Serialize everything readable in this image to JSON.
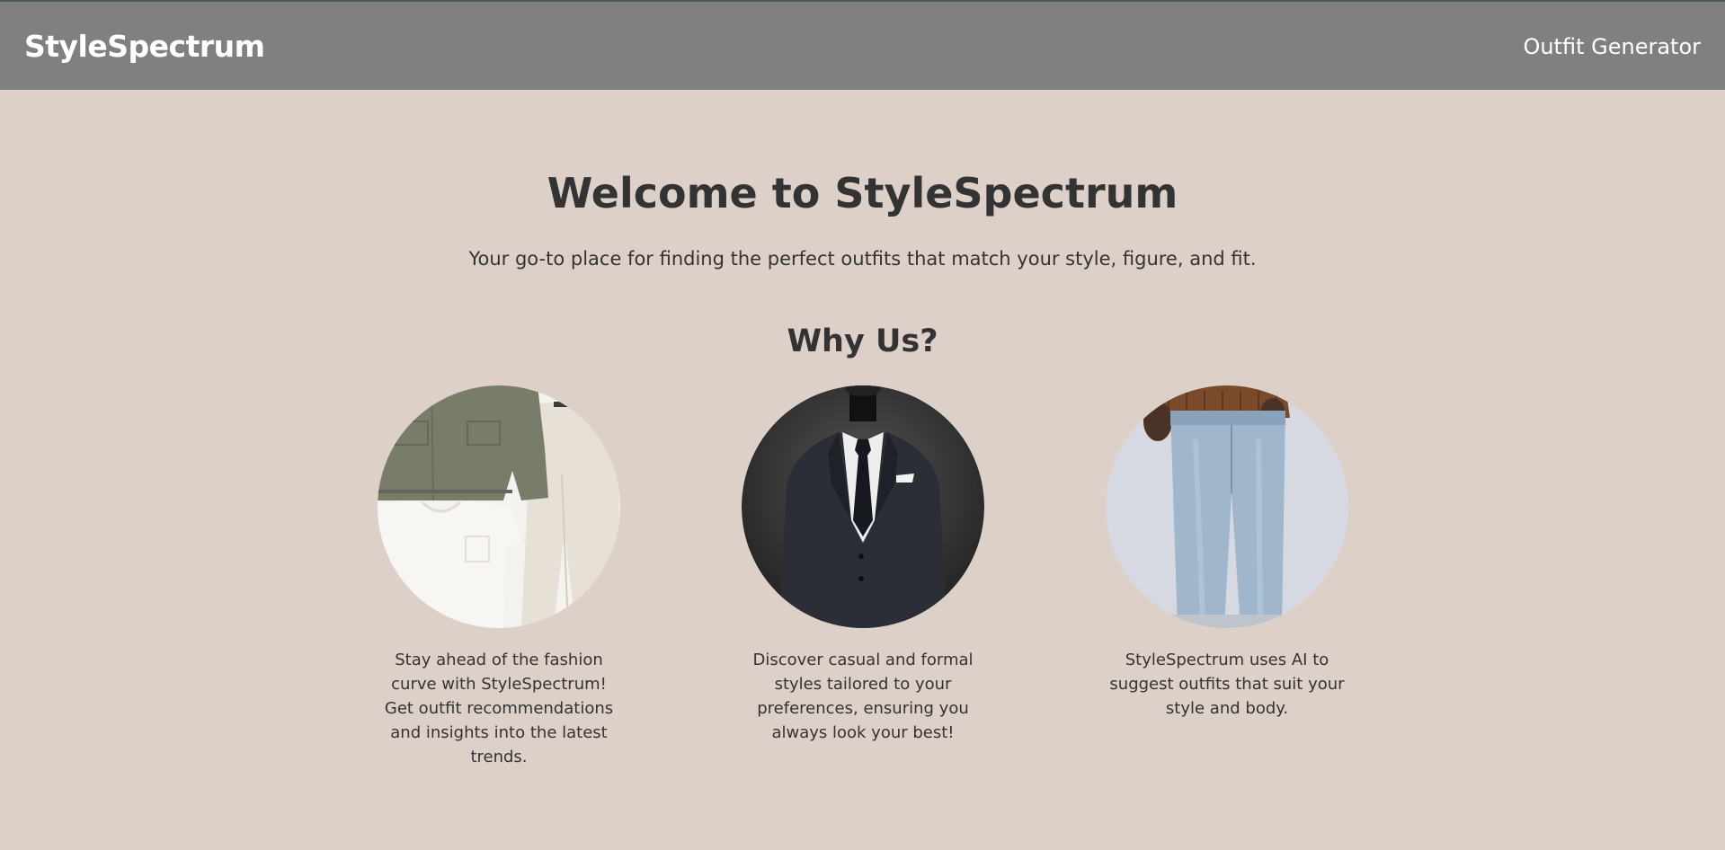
{
  "header": {
    "brand": "StyleSpectrum",
    "nav_link": "Outfit Generator"
  },
  "hero": {
    "title": "Welcome to StyleSpectrum",
    "subtitle": "Your go-to place for finding the perfect outfits that match your style, figure, and fit."
  },
  "why_us": {
    "title": "Why Us?",
    "features": [
      {
        "image": "casual-outfit-flatlay-image",
        "text": "Stay ahead of the fashion curve with StyleSpectrum! Get outfit recommendations and insights into the latest trends."
      },
      {
        "image": "formal-suit-mannequin-image",
        "text": "Discover casual and formal styles tailored to your preferences, ensuring you always look your best!"
      },
      {
        "image": "denim-jeans-model-image",
        "text": "StyleSpectrum uses AI to suggest outfits that suit your style and body."
      }
    ]
  },
  "colors": {
    "background": "#ddd0c8",
    "header": "#808080",
    "text": "#333333"
  }
}
